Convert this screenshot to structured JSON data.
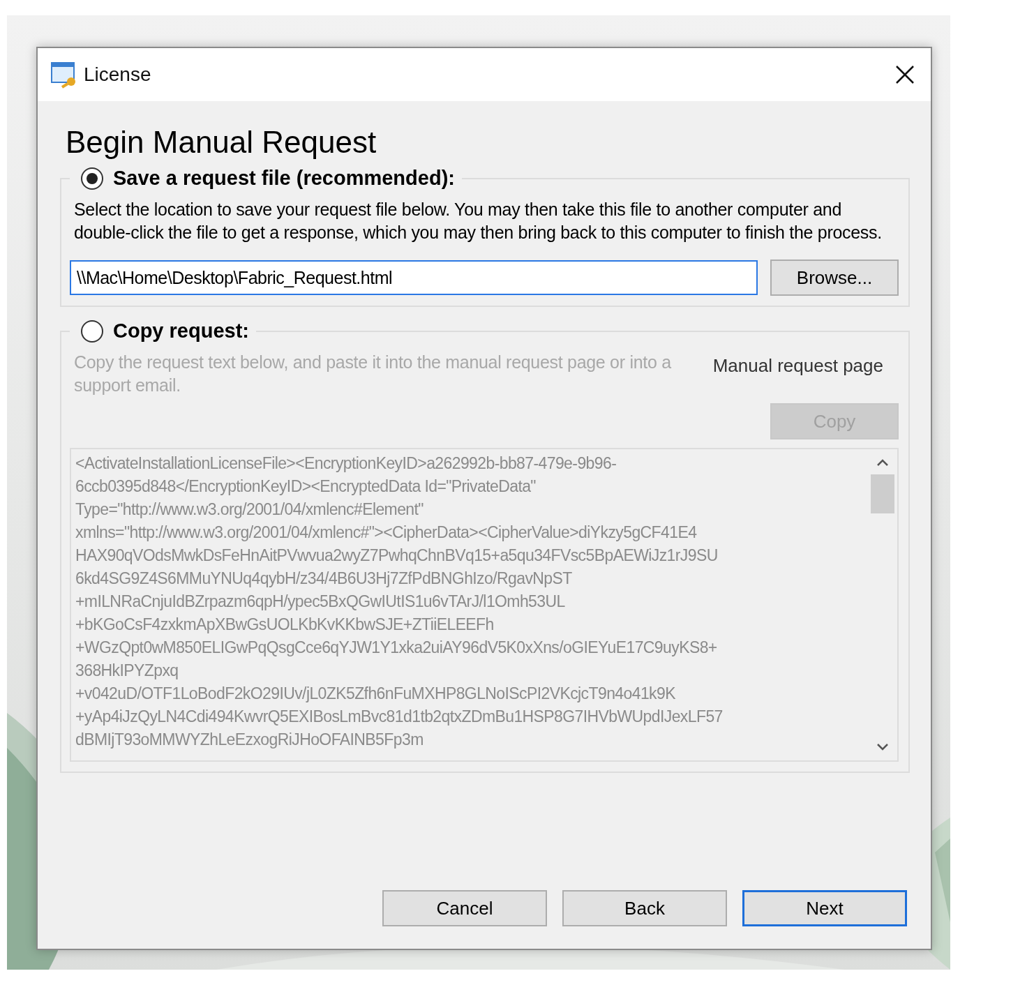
{
  "window": {
    "title": "License"
  },
  "heading": "Begin Manual Request",
  "options": [
    {
      "kind": "file",
      "label": "Save a request file (recommended):",
      "selected": true,
      "description": "Select the location to save your request file below.  You may then take this file to another computer and double-click the file to get a response, which you may then bring back to this computer to finish the process.",
      "path": "\\\\Mac\\Home\\Desktop\\Fabric_Request.html",
      "button": {
        "label": "Browse...",
        "disabled": false
      }
    },
    {
      "kind": "copy",
      "label": "Copy request:",
      "selected": false,
      "description": "Copy the request text below, and paste it into the manual request page or into a support email.",
      "link": "Manual request page",
      "button": {
        "label": "Copy",
        "disabled": true
      },
      "request_lines": [
        "<ActivateInstallationLicenseFile><EncryptionKeyID>a262992b-bb87-479e-9b96-",
        "6ccb0395d848</EncryptionKeyID><EncryptedData Id=\"PrivateData\"",
        "Type=\"http://www.w3.org/2001/04/xmlenc#Element\"",
        "xmlns=\"http://www.w3.org/2001/04/xmlenc#\"><CipherData><CipherValue>diYkzy5gCF41E4",
        "HAX90qVOdsMwkDsFeHnAitPVwvua2wyZ7PwhqChnBVq15+a5qu34FVsc5BpAEWiJz1rJ9SU",
        "6kd4SG9Z4S6MMuYNUq4qybH/z34/4B6U3Hj7ZfPdBNGhIzo/RgavNpST",
        "+mILNRaCnjuIdBZrpazm6qpH/ypec5BxQGwIUtIS1u6vTArJ/l1Omh53UL",
        "+bKGoCsF4zxkmApXBwGsUOLKbKvKKbwSJE+ZTiiELEEFh",
        "+WGzQpt0wM850ELIGwPqQsgCce6qYJW1Y1xka2uiAY96dV5K0xXns/oGIEYuE17C9uyKS8+",
        "368HkIPYZpxq",
        "+v042uD/OTF1LoBodF2kO29IUv/jL0ZK5Zfh6nFuMXHP8GLNoIScPI2VKcjcT9n4o41k9K",
        "+yAp4iJzQyLN4Cdi494KwvrQ5EXIBosLmBvc81d1tb2qtxZDmBu1HSP8G7IHVbWUpdIJexLF57",
        "dBMIjT93oMMWYZhLeEzxogRiJHoOFAINB5Fp3m"
      ]
    }
  ],
  "buttons": [
    {
      "label": "Cancel",
      "default": false
    },
    {
      "label": "Back",
      "default": false
    },
    {
      "label": "Next",
      "default": true
    }
  ]
}
